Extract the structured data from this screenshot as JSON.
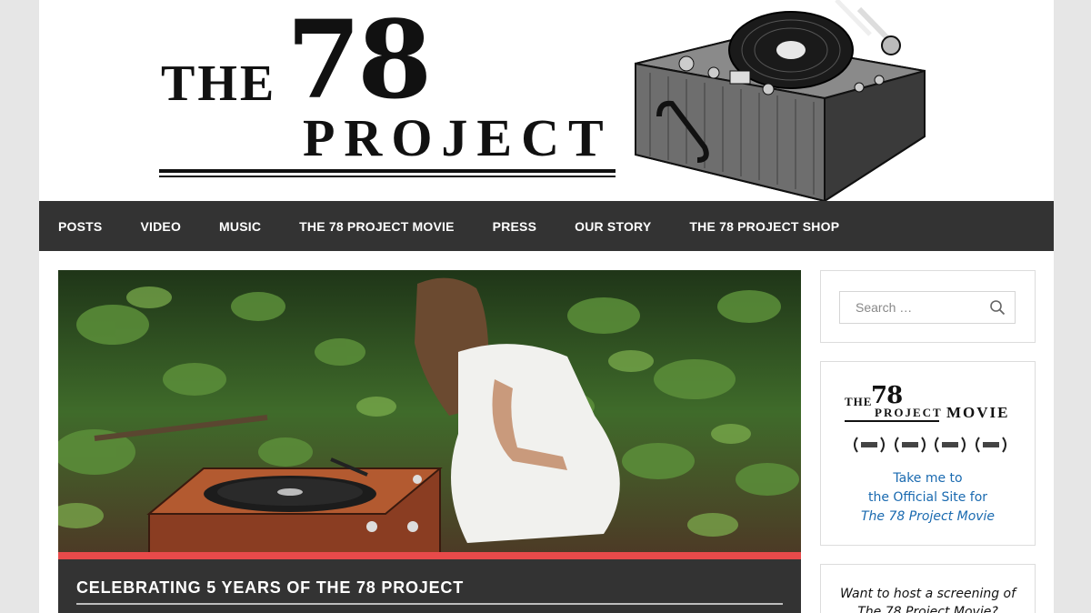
{
  "header": {
    "logo": {
      "the": "THE",
      "number": "78",
      "project": "PROJECT"
    }
  },
  "nav": {
    "items": [
      {
        "label": "POSTS"
      },
      {
        "label": "VIDEO"
      },
      {
        "label": "MUSIC"
      },
      {
        "label": "THE 78 PROJECT MOVIE"
      },
      {
        "label": "PRESS"
      },
      {
        "label": "OUR STORY"
      },
      {
        "label": "THE 78 PROJECT SHOP"
      }
    ]
  },
  "post": {
    "title": "CELEBRATING 5 YEARS OF THE 78 PROJECT"
  },
  "sidebar": {
    "search": {
      "placeholder": "Search …"
    },
    "movie_widget": {
      "logo": {
        "the": "THE",
        "number": "78",
        "project": "PROJECT",
        "movie": "MOVIE"
      },
      "link_line1": "Take me to",
      "link_line2": "the Official Site for",
      "link_line3": "The 78 Project Movie"
    },
    "screening_widget": {
      "line1": "Want to host a screening of",
      "line2": "The 78 Project Movie?"
    }
  },
  "colors": {
    "nav_bg": "#333333",
    "accent_red": "#e84a4a",
    "link_blue": "#1a6ab0"
  }
}
